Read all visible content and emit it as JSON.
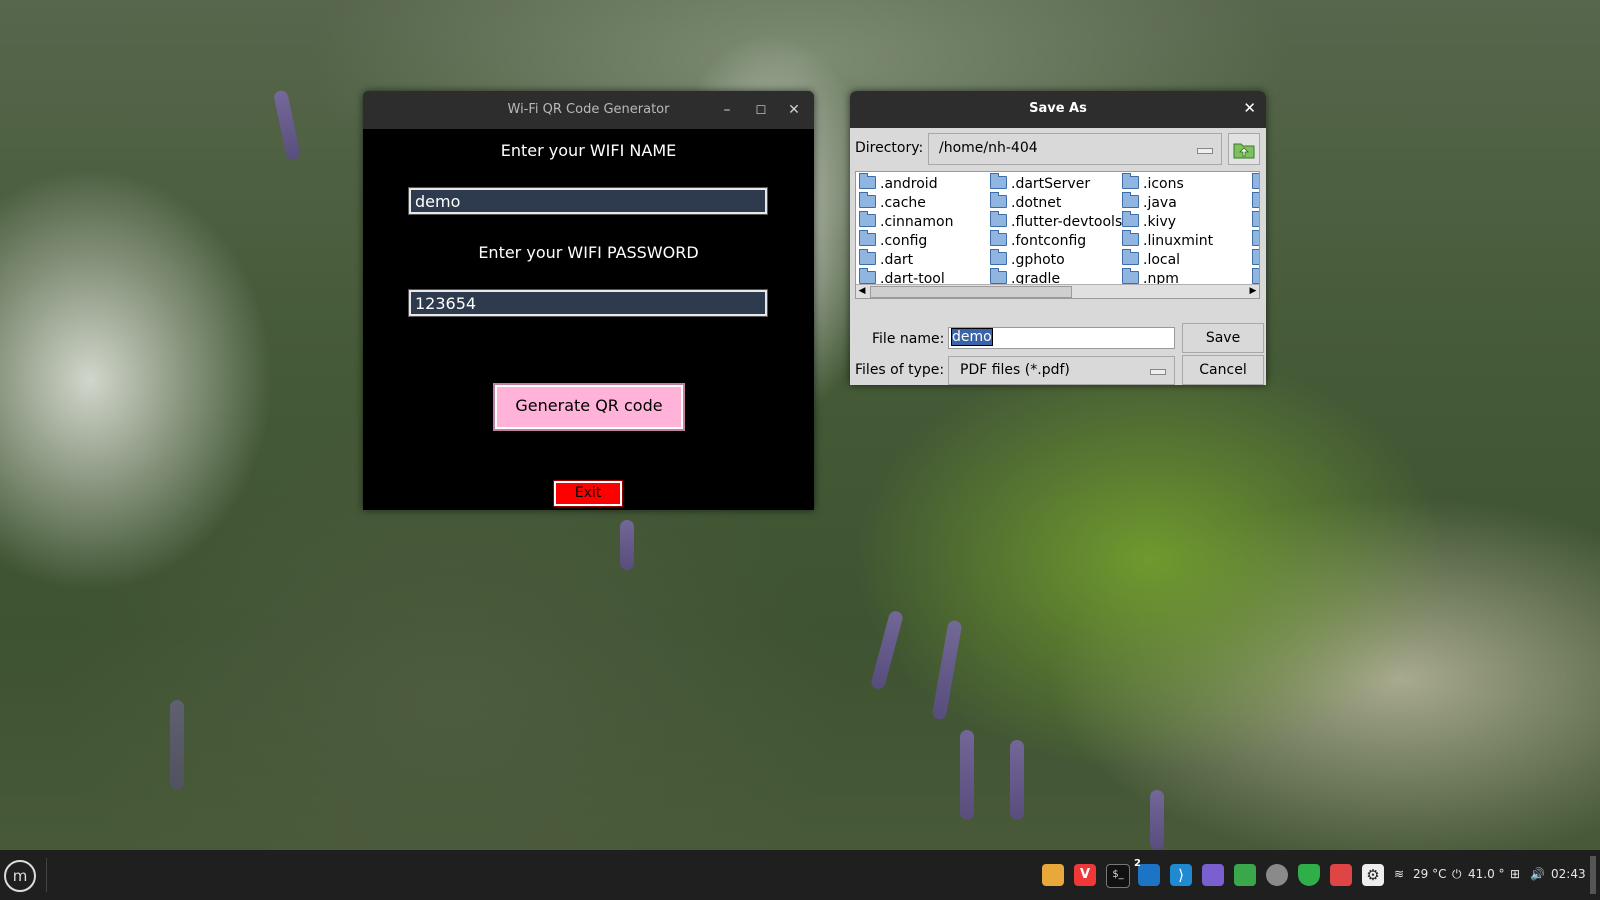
{
  "qr_app": {
    "title": "Wi-Fi QR Code Generator",
    "name_label": "Enter your WIFI NAME",
    "name_value": "demo",
    "password_label": "Enter your WIFI PASSWORD",
    "password_value": "123654",
    "generate_label": "Generate QR code",
    "exit_label": "Exit",
    "colors": {
      "generate_bg": "#ffb3d9",
      "exit_bg": "#ff0000",
      "input_bg": "#2e3b4e"
    }
  },
  "save_dialog": {
    "title": "Save As",
    "directory_label": "Directory:",
    "directory_value": "/home/nh-404",
    "columns": [
      [
        ".android",
        ".cache",
        ".cinnamon",
        ".config",
        ".dart",
        ".dart-tool"
      ],
      [
        ".dartServer",
        ".dotnet",
        ".flutter-devtools",
        ".fontconfig",
        ".gphoto",
        ".gradle"
      ],
      [
        ".icons",
        ".java",
        ".kivy",
        ".linuxmint",
        ".local",
        ".npm"
      ]
    ],
    "file_name_label": "File name:",
    "file_name_value": "demo",
    "files_of_type_label": "Files of type:",
    "files_of_type_value": "PDF files (*.pdf)",
    "save_label": "Save",
    "cancel_label": "Cancel"
  },
  "taskbar": {
    "weather": "29 °C",
    "brightness": "41.0 °",
    "clock": "02:43",
    "vscode_badge": "2",
    "icons": [
      "menu-icon",
      "files-icon",
      "vivaldi-icon",
      "terminal-icon",
      "flutter-icon",
      "vscode-icon",
      "screenshot-icon",
      "spreadsheet-icon",
      "chat-icon",
      "shield-icon",
      "image-viewer-icon",
      "settings-icon"
    ]
  }
}
